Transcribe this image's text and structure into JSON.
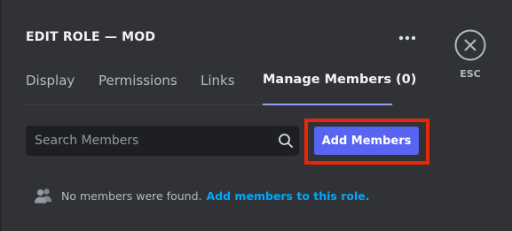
{
  "header": {
    "title": "EDIT ROLE — MOD",
    "more_icon": "more-horizontal-icon",
    "close_icon": "close-circle-icon",
    "esc_label": "ESC"
  },
  "tabs": [
    {
      "label": "Display",
      "active": false
    },
    {
      "label": "Permissions",
      "active": false
    },
    {
      "label": "Links",
      "active": false
    },
    {
      "label": "Manage Members (0)",
      "active": true
    }
  ],
  "search": {
    "placeholder": "Search Members",
    "value": "",
    "icon": "search-icon"
  },
  "add_members_button": {
    "label": "Add Members"
  },
  "empty_state": {
    "icon": "people-icon",
    "message": "No members were found.",
    "link_text": "Add members to this role."
  },
  "colors": {
    "background": "#303236",
    "accent": "#5865f2",
    "link": "#00a8fc",
    "tab_underline": "#949cf7",
    "highlight_box": "#e8260a"
  }
}
